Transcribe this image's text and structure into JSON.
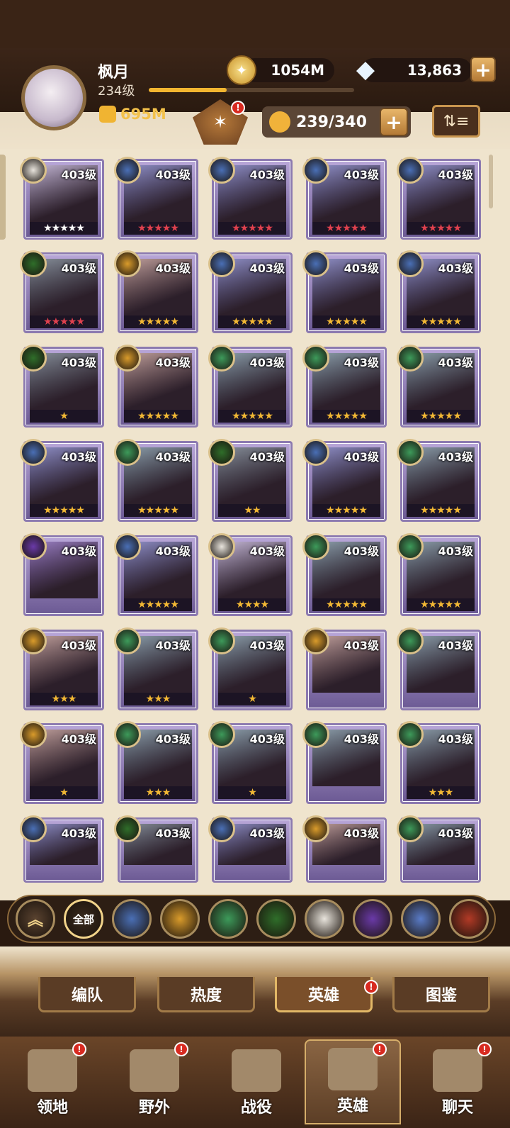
{
  "player": {
    "name": "枫月",
    "level": "234级",
    "power": "695M",
    "xp_progress": 0.38
  },
  "resources": {
    "gold": "1054M",
    "diamonds": "13,863"
  },
  "roster": {
    "count": "239/340"
  },
  "heroes": [
    {
      "level": "403级",
      "stars": "★★★★★",
      "star_color": "white",
      "faction": "celestial"
    },
    {
      "level": "403级",
      "stars": "★★★★★",
      "star_color": "red",
      "faction": "lightbearer"
    },
    {
      "level": "403级",
      "stars": "★★★★★",
      "star_color": "red",
      "faction": "lightbearer"
    },
    {
      "level": "403级",
      "stars": "★★★★★",
      "star_color": "red",
      "faction": "lightbearer"
    },
    {
      "level": "403级",
      "stars": "★★★★★",
      "star_color": "red",
      "faction": "lightbearer"
    },
    {
      "level": "403级",
      "stars": "★★★★★",
      "star_color": "red",
      "faction": "graveborn"
    },
    {
      "level": "403级",
      "stars": "★★★★★",
      "star_color": "gold",
      "faction": "mauler"
    },
    {
      "level": "403级",
      "stars": "★★★★★",
      "star_color": "gold",
      "faction": "lightbearer"
    },
    {
      "level": "403级",
      "stars": "★★★★★",
      "star_color": "gold",
      "faction": "lightbearer"
    },
    {
      "level": "403级",
      "stars": "★★★★★",
      "star_color": "gold",
      "faction": "lightbearer"
    },
    {
      "level": "403级",
      "stars": "★",
      "star_color": "gold",
      "faction": "graveborn"
    },
    {
      "level": "403级",
      "stars": "★★★★★",
      "star_color": "gold",
      "faction": "mauler"
    },
    {
      "level": "403级",
      "stars": "★★★★★",
      "star_color": "gold",
      "faction": "wilder"
    },
    {
      "level": "403级",
      "stars": "★★★★★",
      "star_color": "gold",
      "faction": "wilder"
    },
    {
      "level": "403级",
      "stars": "★★★★★",
      "star_color": "gold",
      "faction": "wilder"
    },
    {
      "level": "403级",
      "stars": "★★★★★",
      "star_color": "gold",
      "faction": "lightbearer"
    },
    {
      "level": "403级",
      "stars": "★★★★★",
      "star_color": "gold",
      "faction": "wilder"
    },
    {
      "level": "403级",
      "stars": "★★",
      "star_color": "gold",
      "faction": "graveborn"
    },
    {
      "level": "403级",
      "stars": "★★★★★",
      "star_color": "gold",
      "faction": "lightbearer"
    },
    {
      "level": "403级",
      "stars": "★★★★★",
      "star_color": "gold",
      "faction": "wilder"
    },
    {
      "level": "403级",
      "stars": "",
      "star_color": "gold",
      "faction": "hypogean"
    },
    {
      "level": "403级",
      "stars": "★★★★★",
      "star_color": "gold",
      "faction": "lightbearer"
    },
    {
      "level": "403级",
      "stars": "★★★★",
      "star_color": "gold",
      "faction": "celestial"
    },
    {
      "level": "403级",
      "stars": "★★★★★",
      "star_color": "gold",
      "faction": "wilder"
    },
    {
      "level": "403级",
      "stars": "★★★★★",
      "star_color": "gold",
      "faction": "wilder"
    },
    {
      "level": "403级",
      "stars": "★★★",
      "star_color": "gold",
      "faction": "mauler"
    },
    {
      "level": "403级",
      "stars": "★★★",
      "star_color": "gold",
      "faction": "wilder"
    },
    {
      "level": "403级",
      "stars": "★",
      "star_color": "gold",
      "faction": "wilder"
    },
    {
      "level": "403级",
      "stars": "",
      "star_color": "gold",
      "faction": "mauler"
    },
    {
      "level": "403级",
      "stars": "",
      "star_color": "gold",
      "faction": "wilder"
    },
    {
      "level": "403级",
      "stars": "★",
      "star_color": "gold",
      "faction": "mauler"
    },
    {
      "level": "403级",
      "stars": "★★★",
      "star_color": "gold",
      "faction": "wilder"
    },
    {
      "level": "403级",
      "stars": "★",
      "star_color": "gold",
      "faction": "wilder"
    },
    {
      "level": "403级",
      "stars": "",
      "star_color": "gold",
      "faction": "wilder"
    },
    {
      "level": "403级",
      "stars": "★★★",
      "star_color": "gold",
      "faction": "wilder"
    },
    {
      "level": "403级",
      "stars": "",
      "star_color": "gold",
      "faction": "lightbearer"
    },
    {
      "level": "403级",
      "stars": "",
      "star_color": "gold",
      "faction": "graveborn"
    },
    {
      "level": "403级",
      "stars": "",
      "star_color": "gold",
      "faction": "lightbearer"
    },
    {
      "level": "403级",
      "stars": "",
      "star_color": "gold",
      "faction": "mauler"
    },
    {
      "level": "403级",
      "stars": "",
      "star_color": "gold",
      "faction": "wilder"
    }
  ],
  "filters": {
    "all_label": "全部",
    "items": [
      "collapse",
      "all",
      "lightbearer",
      "mauler",
      "wilder",
      "graveborn",
      "celestial",
      "hypogean",
      "dimensional",
      "dragon"
    ]
  },
  "subtabs": [
    {
      "label": "编队",
      "active": false,
      "badge": false
    },
    {
      "label": "热度",
      "active": false,
      "badge": false
    },
    {
      "label": "英雄",
      "active": true,
      "badge": true
    },
    {
      "label": "图鉴",
      "active": false,
      "badge": false
    }
  ],
  "nav": [
    {
      "label": "领地",
      "active": false,
      "badge": true
    },
    {
      "label": "野外",
      "active": false,
      "badge": true
    },
    {
      "label": "战役",
      "active": false,
      "badge": false
    },
    {
      "label": "英雄",
      "active": true,
      "badge": true
    },
    {
      "label": "聊天",
      "active": false,
      "badge": true
    }
  ],
  "badge_mark": "!",
  "colors": {
    "star_gold": "#f2b834",
    "star_red": "#e0414e",
    "star_white": "#ffffff",
    "badge_red": "#d82a20",
    "faction_lightbearer": "#4a6fb5",
    "faction_mauler": "#d99b2b",
    "faction_wilder": "#3d9a5a",
    "faction_graveborn": "#2f6e2a",
    "faction_celestial": "#e8e4dc",
    "faction_hypogean": "#6a3aa8",
    "faction_dimensional": "#5a7cc8",
    "faction_dragon": "#b23a26"
  }
}
